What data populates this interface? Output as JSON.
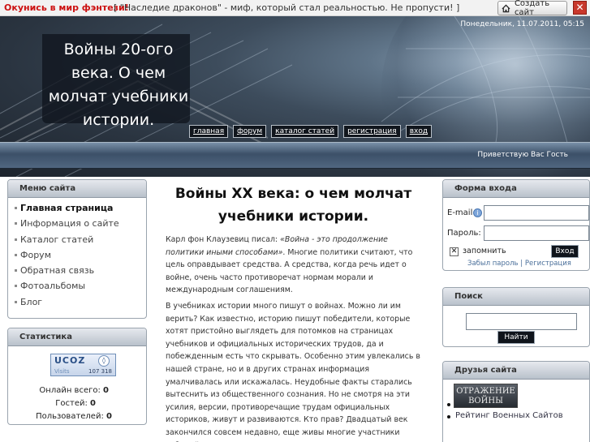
{
  "topbar": {
    "promo_link": "Окунись в мир фэнтези!",
    "promo_text": "[ \"Наследие драконов\" - миф, который стал реальностью. Не пропусти! ]",
    "create_site": "Создать сайт",
    "close": "✕"
  },
  "header": {
    "site_title": "Войны 20-ого века. О чем молчат учебники истории.",
    "date": "Понедельник, 11.07.2011, 05:15",
    "nav": [
      "главная",
      "форум",
      "каталог статей",
      "регистрация",
      "вход"
    ],
    "greeting": "Приветствую Вас Гость"
  },
  "menu": {
    "title": "Меню сайта",
    "items": [
      "Главная страница",
      "Информация о сайте",
      "Каталог статей",
      "Форум",
      "Обратная связь",
      "Фотоальбомы",
      "Блог"
    ]
  },
  "stats": {
    "title": "Статистика",
    "counter_logo": "UCOZ",
    "counter_label": "Visits",
    "counter_value": "107 318",
    "online_label": "Онлайн всего:",
    "online_value": "0",
    "guests_label": "Гостей:",
    "guests_value": "0",
    "users_label": "Пользователей:",
    "users_value": "0"
  },
  "article": {
    "title": "Войны XX века: о чем молчат учебники истории.",
    "p1_lead": "Карл фон Клаузевиц писал: ",
    "p1_quote": "«Война - это продолжение политики иными способами»",
    "p1_rest": ". Многие политики считают, что цель оправдывает средства. А средства, когда речь идет о войне, очень часто противоречат нормам морали и международным соглашениям.",
    "p2": "В учебниках истории много пишут о войнах. Можно ли им верить? Как известно, историю пишут победители, которые хотят пристойно выглядеть для потомков на страницах учебников и официальных исторических трудов, да и побежденным есть что скрывать. Особенно этим увлекались в нашей стране, но и в других странах информация умалчивалась или искажалась. Неудобные факты старались вытеснить из общественного сознания. Но не смотря на эти усилия, версии, противоречащие трудам официальных историков, живут и развиваются. Кто прав? Двадцатый век закончился совсем недавно, еще живы многие участники событий, политики вынуждены учитывать, как недавняя история поможет или помешает их сегодняшним планам. Наверное"
  },
  "login": {
    "title": "Форма входа",
    "email_label": "E-mail:",
    "password_label": "Пароль:",
    "remember_label": "запомнить",
    "submit": "Вход",
    "forgot_link": "Забыл пароль",
    "separator": "|",
    "register_link": "Регистрация"
  },
  "search": {
    "title": "Поиск",
    "button": "Найти"
  },
  "friends": {
    "title": "Друзья сайта",
    "banner_text": "ОТРАЖЕНИЕ ВОЙНЫ",
    "rating_link": "Рейтинг Военных Сайтов"
  },
  "colors": {
    "promo_red": "#cc1111",
    "nav_button_bg": "#11161d",
    "panel_header": "#c5ccd5"
  }
}
